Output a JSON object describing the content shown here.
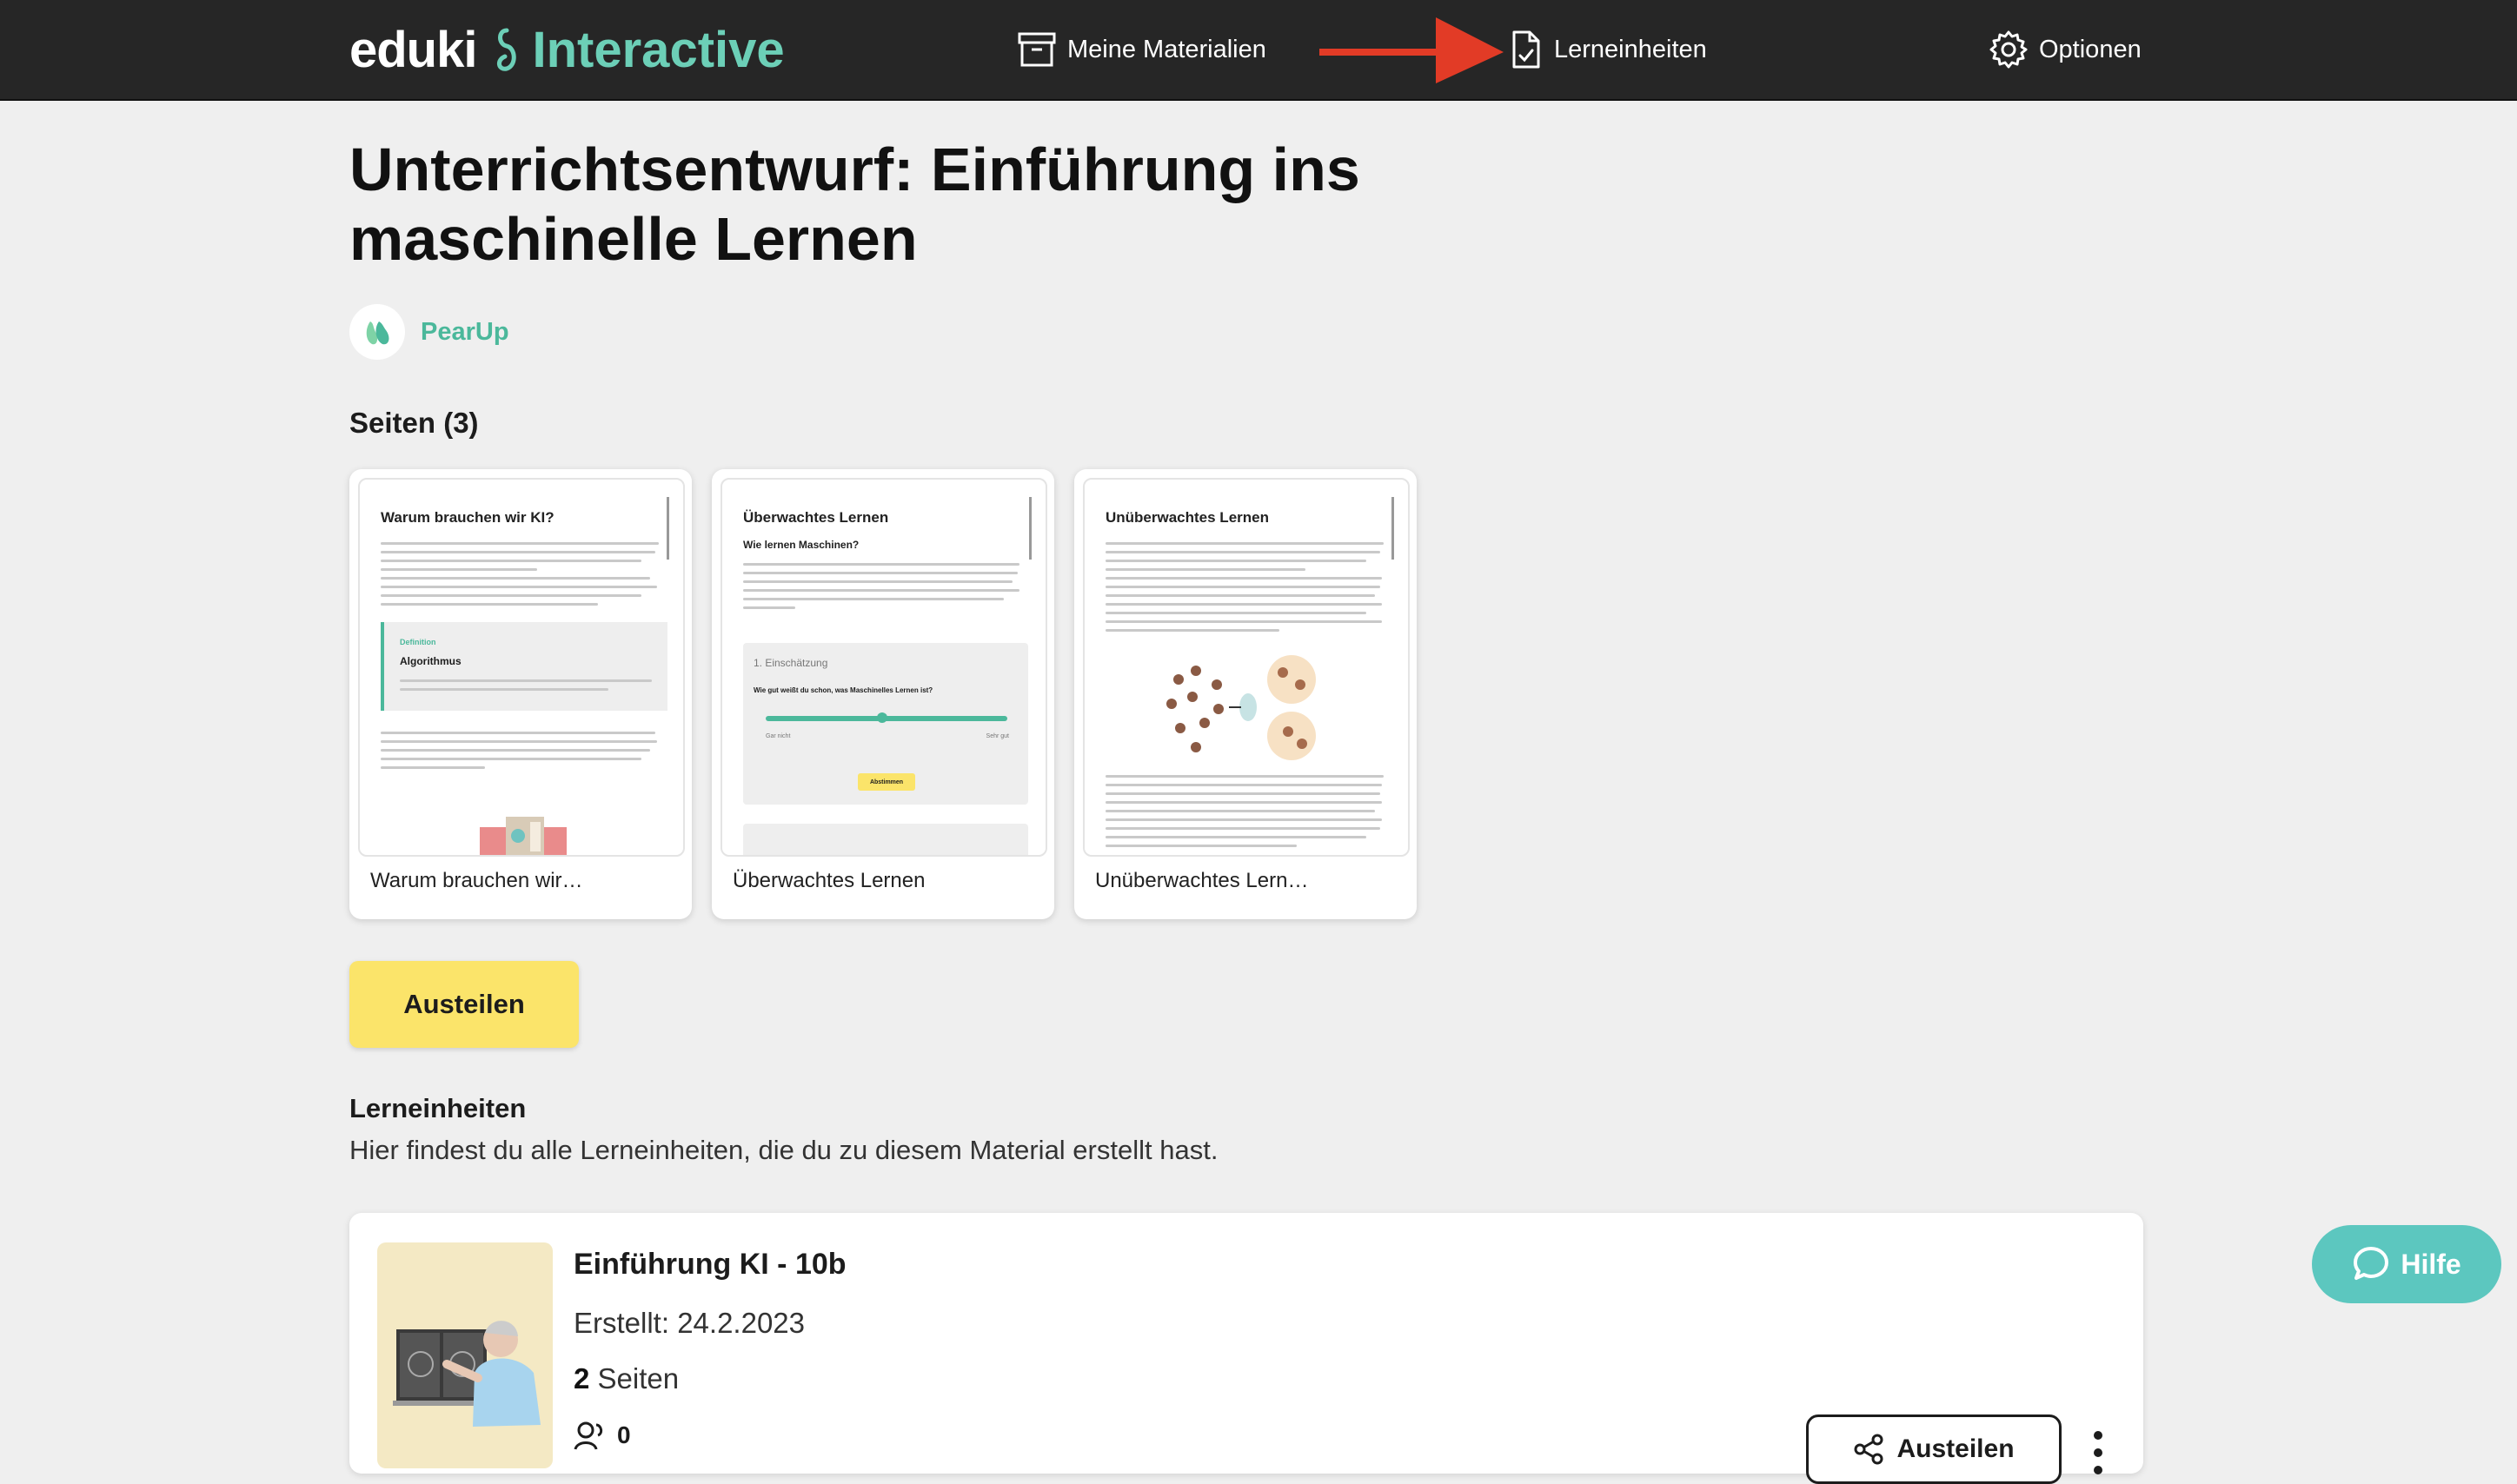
{
  "nav": {
    "logo_main": "eduki",
    "logo_sub": "Interactive",
    "items": [
      {
        "label": "Meine Materialien",
        "icon": "archive-icon"
      },
      {
        "label": "Lerneinheiten",
        "icon": "document-check-icon"
      },
      {
        "label": "Optionen",
        "icon": "gear-icon"
      }
    ],
    "arrow_color": "#e23b26"
  },
  "material": {
    "title": "Unterrichtsentwurf: Einführung ins maschinelle Lernen",
    "author": "PearUp"
  },
  "pages": {
    "heading": "Seiten (3)",
    "cards": [
      {
        "label": "Warum brauchen wir…",
        "thumb_title": "Warum brauchen wir KI?",
        "definition_label": "Definition",
        "definition_term": "Algorithmus"
      },
      {
        "label": "Überwachtes Lernen",
        "thumb_title": "Überwachtes Lernen",
        "thumb_subtitle": "Wie lernen Maschinen?",
        "quiz_label": "1. Einschätzung",
        "quiz_question": "Wie gut weißt du schon, was Maschinelles Lernen ist?",
        "slider_min": "Gar nicht",
        "slider_max": "Sehr gut",
        "vote_button": "Abstimmen"
      },
      {
        "label": "Unüberwachtes Lern…",
        "thumb_title": "Unüberwachtes Lernen"
      }
    ]
  },
  "share_button": "Austeilen",
  "units": {
    "heading": "Lerneinheiten",
    "description": "Hier findest du alle Lerneinheiten, die du zu diesem Material erstellt hast.",
    "items": [
      {
        "title": "Einführung KI - 10b",
        "created": "Erstellt: 24.2.2023",
        "pages_count": "2",
        "pages_label": "Seiten",
        "students": "0",
        "share_label": "Austeilen"
      }
    ]
  },
  "help_button": "Hilfe",
  "colors": {
    "nav_bg": "#262626",
    "accent_teal": "#6ccfb7",
    "share_yellow": "#fbe46a",
    "help_teal": "#5cc7bf"
  }
}
